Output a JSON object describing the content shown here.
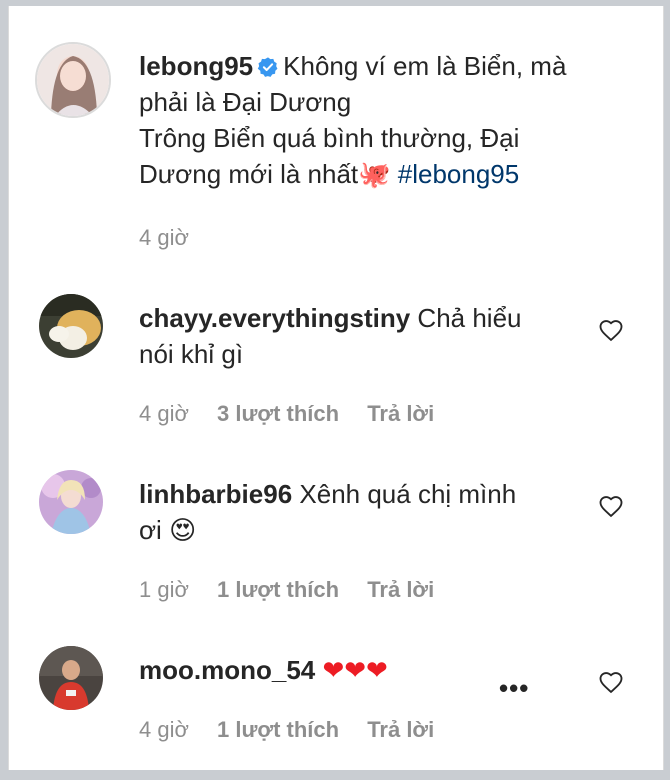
{
  "caption": {
    "username": "lebong95",
    "verified": true,
    "line1": "Không ví em là Biển, mà",
    "line2": "phải là Đại Dương",
    "line3": "Trông Biển quá bình thường, Đại",
    "line4_text": "Dương mới là nhất",
    "line4_emoji": "🐙",
    "hashtag": "#lebong95",
    "time": "4 giờ"
  },
  "comments": [
    {
      "username": "chayy.everythingstiny",
      "text_line1": "Chả hiểu",
      "text_line2": "nói khỉ gì",
      "time": "4 giờ",
      "likes": "3 lượt thích",
      "reply": "Trả lời"
    },
    {
      "username": "linhbarbie96",
      "text_line1": "Xênh quá chị mình",
      "text_line2": "ơi",
      "emoji": "😍",
      "time": "1 giờ",
      "likes": "1 lượt thích",
      "reply": "Trả lời"
    },
    {
      "username": "moo.mono_54",
      "emoji": "❤❤❤",
      "time": "4 giờ",
      "likes": "1 lượt thích",
      "reply": "Trả lời",
      "more": "•••"
    }
  ],
  "colors": {
    "text": "#262626",
    "secondary": "#8e8e8e",
    "link": "#00376b",
    "verified": "#3897f0"
  }
}
